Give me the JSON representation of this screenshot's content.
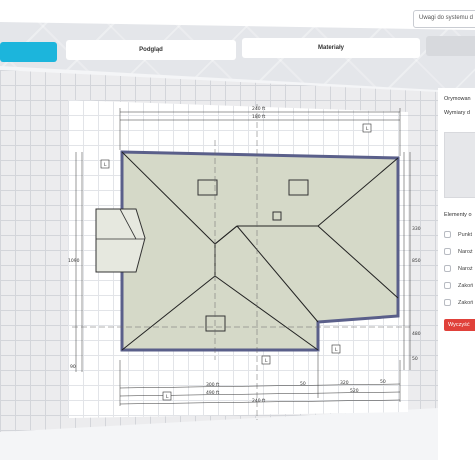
{
  "header": {
    "notes_placeholder": "Uwagi do systemu d"
  },
  "tabs": [
    {
      "label": "",
      "state": "active"
    },
    {
      "label": "Podgląd",
      "state": "plain"
    },
    {
      "label": "Materiały",
      "state": "plain"
    },
    {
      "label": "",
      "state": "grey"
    }
  ],
  "side": {
    "label_1": "Orymowan",
    "label_2": "Wymiary d",
    "elements_title": "Elementy o",
    "options": [
      "Punkt",
      "Naroż",
      "Naroż",
      "Zakoń",
      "Zakoń"
    ],
    "clear_label": "Wyczyść"
  },
  "plan": {
    "dims_top": [
      "240 ft",
      "180 ft"
    ],
    "dims_bottom_1": [
      "300 ft",
      "50",
      "320",
      "50"
    ],
    "dims_bottom_2": [
      "490 ft",
      "520"
    ],
    "dims_bottom_3": [
      "240 ft"
    ],
    "dims_right": [
      "330",
      "850",
      "480",
      "50"
    ],
    "dims_left": [
      "1090",
      "90"
    ],
    "tags": [
      "L",
      "L",
      "L",
      "L",
      "L"
    ],
    "colors": {
      "roof_fill": "#d5d9c8",
      "roof_outline": "#5a5f8a",
      "accent": "#1cb5dc",
      "danger": "#e0413a"
    }
  }
}
